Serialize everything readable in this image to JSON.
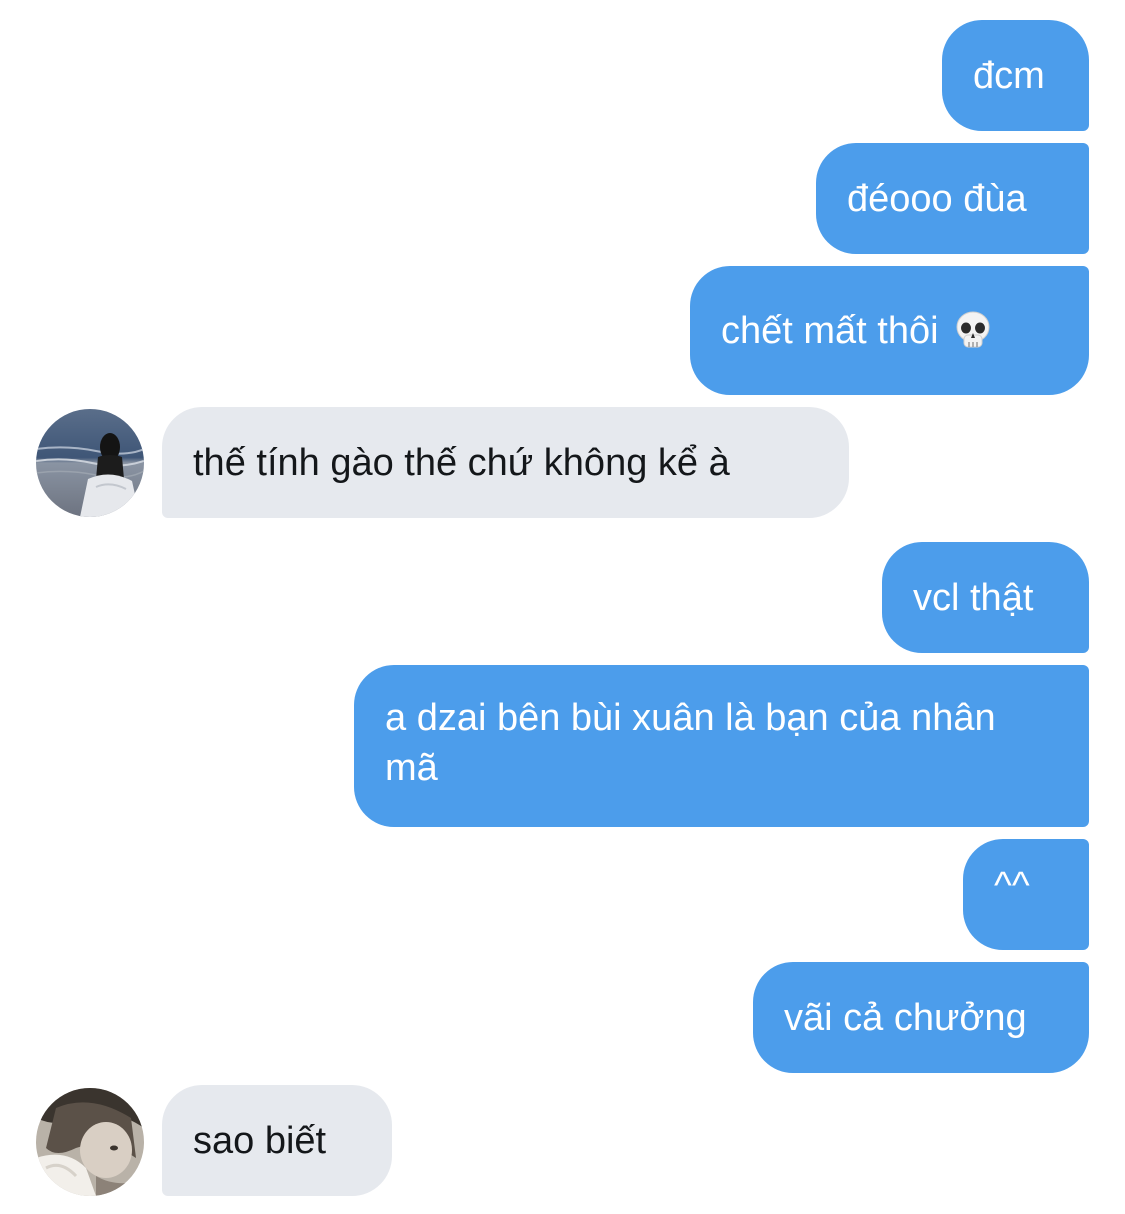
{
  "conversation": {
    "messages": [
      {
        "id": "m1",
        "sender": "me",
        "text": "đcm"
      },
      {
        "id": "m2",
        "sender": "me",
        "text": "đéooo đùa"
      },
      {
        "id": "m3",
        "sender": "me",
        "text": "chết mất thôi",
        "emoji_icon": "skull-icon"
      },
      {
        "id": "m4",
        "sender": "other",
        "text": "thế tính gào thế chứ không kể à"
      },
      {
        "id": "m5",
        "sender": "me",
        "text": "vcl thật"
      },
      {
        "id": "m6",
        "sender": "me",
        "text": "a dzai bên bùi xuân là bạn của nhân mã"
      },
      {
        "id": "m7",
        "sender": "me",
        "text": "^^"
      },
      {
        "id": "m8",
        "sender": "me",
        "text": "vãi cả chưởng"
      },
      {
        "id": "m9",
        "sender": "other",
        "text": "sao biết"
      }
    ]
  },
  "colors": {
    "outgoing_bubble": "#4C9DEB",
    "incoming_bubble": "#E6E9EE",
    "outgoing_text": "#FFFFFF",
    "incoming_text": "#14171A"
  }
}
